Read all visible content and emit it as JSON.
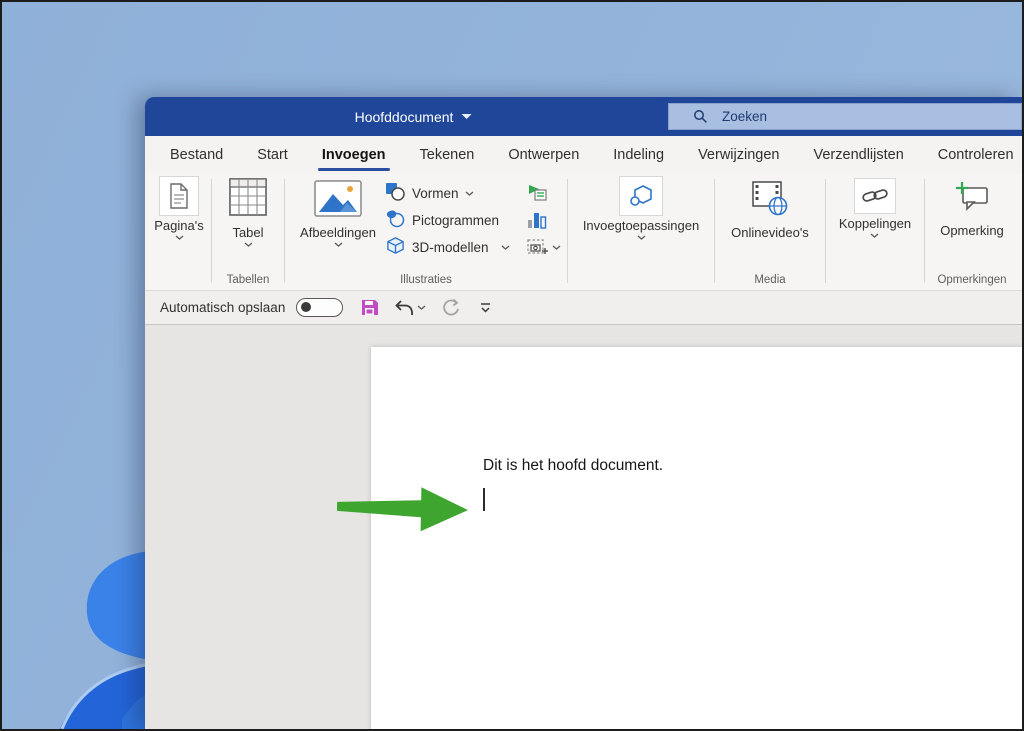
{
  "window": {
    "title": "Hoofddocument",
    "search": {
      "placeholder": "Zoeken"
    },
    "tabs": [
      {
        "label": "Bestand",
        "active": false
      },
      {
        "label": "Start",
        "active": false
      },
      {
        "label": "Invoegen",
        "active": true
      },
      {
        "label": "Tekenen",
        "active": false
      },
      {
        "label": "Ontwerpen",
        "active": false
      },
      {
        "label": "Indeling",
        "active": false
      },
      {
        "label": "Verwijzingen",
        "active": false
      },
      {
        "label": "Verzendlijsten",
        "active": false
      },
      {
        "label": "Controleren",
        "active": false
      }
    ],
    "ribbon": {
      "pages": {
        "button": "Pagina's"
      },
      "tables": {
        "button": "Tabel",
        "group_label": "Tabellen"
      },
      "illustrations": {
        "images_button": "Afbeeldingen",
        "shapes_button": "Vormen",
        "icons_button": "Pictogrammen",
        "models_button": "3D-modellen",
        "group_label": "Illustraties"
      },
      "addins": {
        "button": "Invoegtoepassingen"
      },
      "media": {
        "video_button": "Onlinevideo's",
        "group_label": "Media"
      },
      "links": {
        "button": "Koppelingen"
      },
      "comments": {
        "button": "Opmerking",
        "group_label": "Opmerkingen"
      }
    },
    "qat": {
      "autosave_label": "Automatisch opslaan",
      "autosave_state": "off"
    },
    "document": {
      "body_text": "Dit is het hoofd document."
    }
  },
  "colors": {
    "titlebar": "#1F4699",
    "search_bg": "#A9BFE2",
    "tab_underline": "#2B4FA0",
    "office_icon_blue": "#2E74C9",
    "save_icon_magenta": "#C04BC4",
    "comment_plus_green": "#33A852",
    "pointer_arrow_green": "#3EA52F"
  }
}
